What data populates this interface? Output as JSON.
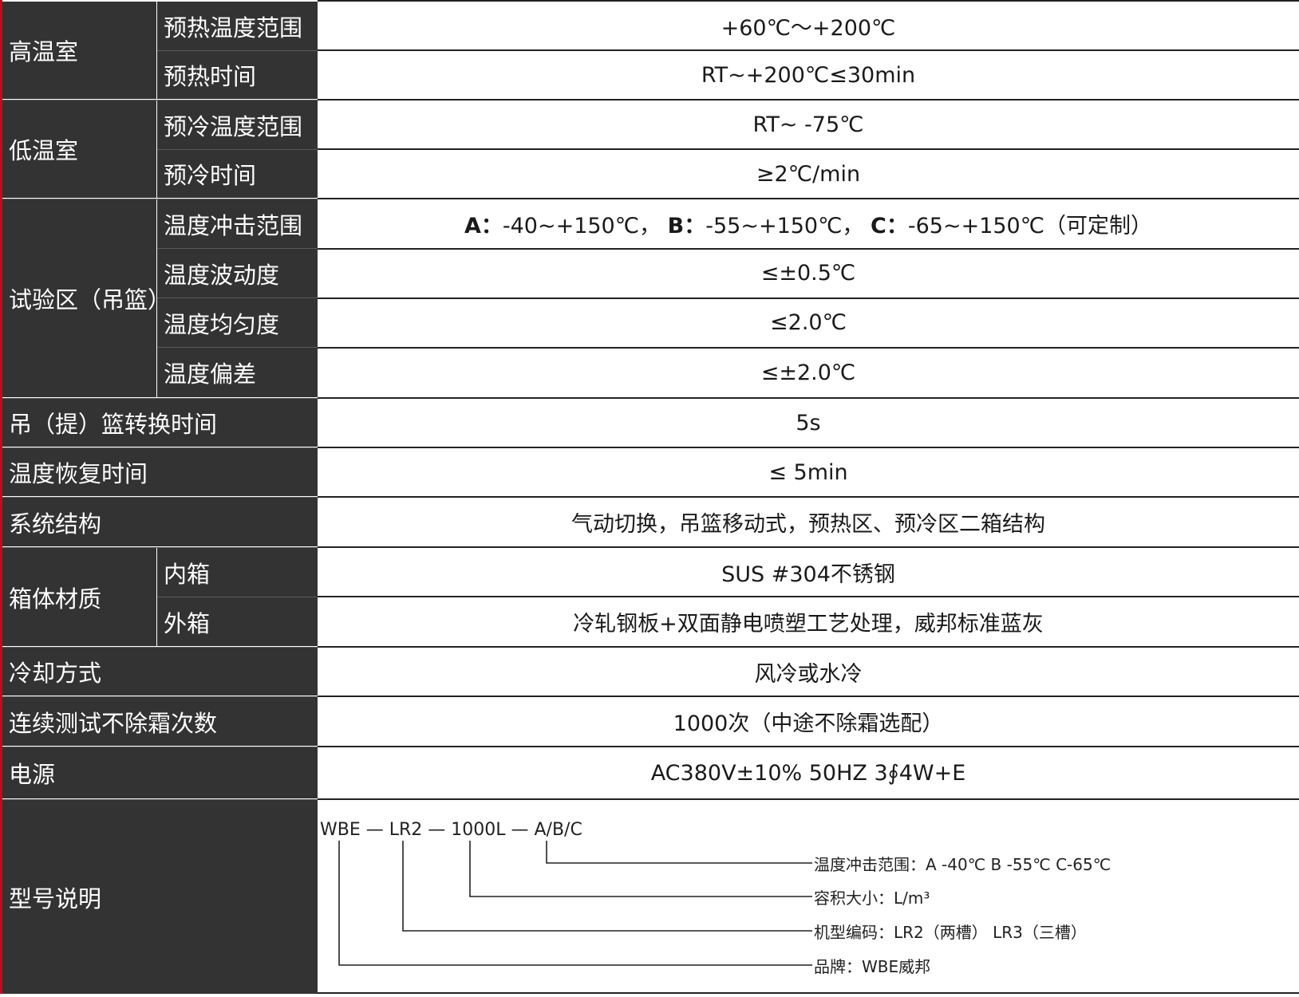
{
  "rows": [
    {
      "label": "高温室",
      "sub": "预热温度范围",
      "value": "+60℃～+200℃"
    },
    {
      "sub": "预热时间",
      "value": "RT~+200℃≤30min"
    },
    {
      "label": "低温室",
      "sub": "预冷温度范围",
      "value": "RT~ -75℃"
    },
    {
      "sub": "预冷时间",
      "value": "≥2℃/min"
    },
    {
      "label": "试验区（吊篮）",
      "sub": "温度冲击范围",
      "value": {
        "a_label": "A：",
        "a_value": "-40~+150℃，",
        "b_label": "B：",
        "b_value": "-55~+150℃，",
        "c_label": "C：",
        "c_value": "-65~+150℃（可定制）"
      }
    },
    {
      "sub": "温度波动度",
      "value": "≤±0.5℃"
    },
    {
      "sub": "温度均匀度",
      "value": "≤2.0℃"
    },
    {
      "sub": "温度偏差",
      "value": "≤±2.0℃"
    },
    {
      "label": "吊（提）篮转换时间",
      "value": "5s"
    },
    {
      "label": "温度恢复时间",
      "value": "≤ 5min"
    },
    {
      "label": "系统结构",
      "value": "气动切换，吊篮移动式，预热区、预冷区二箱结构"
    },
    {
      "label": "箱体材质",
      "sub": "内箱",
      "value": "SUS #304不锈钢"
    },
    {
      "sub": "外箱",
      "value": "冷轧钢板+双面静电喷塑工艺处理，威邦标准蓝灰"
    },
    {
      "label": "冷却方式",
      "value": "风冷或水冷"
    },
    {
      "label": "连续测试不除霜次数",
      "value": "1000次（中途不除霜选配）"
    },
    {
      "label": "电源",
      "value": "AC380V±10% 50HZ 3∮4W+E"
    },
    {
      "label": "型号说明"
    }
  ],
  "model": {
    "code": "WBE — LR2 — 1000L — A/B/C",
    "notes": [
      "温度冲击范围：A -40℃  B -55℃  C-65℃",
      "容积大小：L/m³",
      "机型编码：LR2（两槽） LR3（三槽）",
      "品牌：WBE威邦"
    ]
  }
}
